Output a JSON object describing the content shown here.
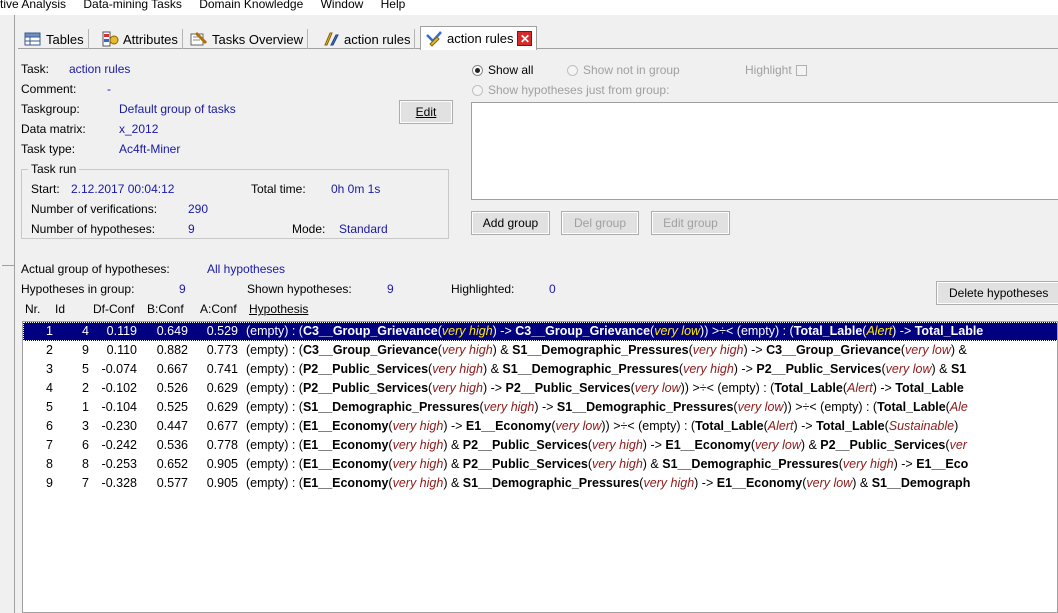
{
  "menu": [
    "tive Analysis",
    "Data-mining Tasks",
    "Domain Knowledge",
    "Window",
    "Help"
  ],
  "tabs": [
    {
      "label": "Tables",
      "icon": "table-icon"
    },
    {
      "label": "Attributes",
      "icon": "attributes-icon"
    },
    {
      "label": "Tasks Overview",
      "icon": "tasks-overview-icon"
    },
    {
      "label": "action rules",
      "icon": "action-rules-icon"
    },
    {
      "label": "action rules",
      "icon": "action-rules-icon",
      "active": true
    }
  ],
  "task": {
    "task_label": "Task:",
    "task_value": "action rules",
    "comment_label": "Comment:",
    "comment_value": "-",
    "taskgroup_label": "Taskgroup:",
    "taskgroup_value": "Default group of tasks",
    "datamatrix_label": "Data matrix:",
    "datamatrix_value": "x_2012",
    "tasktype_label": "Task type:",
    "tasktype_value": "Ac4ft-Miner",
    "edit_button": "Edit"
  },
  "taskrun": {
    "legend": "Task run",
    "start_label": "Start:",
    "start_value": "2.12.2017 00:04:12",
    "totaltime_label": "Total time:",
    "totaltime_value": "0h 0m 1s",
    "verifications_label": "Number of verifications:",
    "verifications_value": "290",
    "hypotheses_label": "Number of hypotheses:",
    "hypotheses_value": "9",
    "mode_label": "Mode:",
    "mode_value": "Standard"
  },
  "filter": {
    "show_all": "Show all",
    "show_not_in_group": "Show not in group",
    "highlight": "Highlight",
    "show_from_group": "Show hypotheses just from group:",
    "add_group": "Add group",
    "del_group": "Del group",
    "edit_group": "Edit group"
  },
  "summary": {
    "actual_group_label": "Actual group of hypotheses:",
    "actual_group_value": "All hypotheses",
    "in_group_label": "Hypotheses in group:",
    "in_group_value": "9",
    "shown_label": "Shown hypotheses:",
    "shown_value": "9",
    "highlighted_label": "Highlighted:",
    "highlighted_value": "0",
    "delete_button": "Delete hypotheses"
  },
  "columns": [
    "Nr.",
    "Id",
    "Df-Conf",
    "B:Conf",
    "A:Conf",
    "Hypothesis"
  ],
  "rows": [
    {
      "nr": "1",
      "id": "4",
      "df": "0.119",
      "b": "0.649",
      "a": "0.529",
      "selected": true,
      "hyp": [
        [
          "t",
          "(empty) : ("
        ],
        [
          "b",
          "C3__Group_Grievance"
        ],
        [
          "t",
          "("
        ],
        [
          "i",
          "very high"
        ],
        [
          "t",
          ") -> "
        ],
        [
          "b",
          "C3__Group_Grievance"
        ],
        [
          "t",
          "("
        ],
        [
          "i",
          "very low"
        ],
        [
          "t",
          ")) >÷< (empty) : ("
        ],
        [
          "b",
          "Total_Lable"
        ],
        [
          "t",
          "("
        ],
        [
          "i",
          "Alert"
        ],
        [
          "t",
          ") -> "
        ],
        [
          "b",
          "Total_Lable"
        ]
      ]
    },
    {
      "nr": "2",
      "id": "9",
      "df": "0.110",
      "b": "0.882",
      "a": "0.773",
      "hyp": [
        [
          "t",
          "(empty) : ("
        ],
        [
          "b",
          "C3__Group_Grievance"
        ],
        [
          "t",
          "("
        ],
        [
          "i",
          "very high"
        ],
        [
          "t",
          ") & "
        ],
        [
          "b",
          "S1__Demographic_Pressures"
        ],
        [
          "t",
          "("
        ],
        [
          "i",
          "very high"
        ],
        [
          "t",
          ") -> "
        ],
        [
          "b",
          "C3__Group_Grievance"
        ],
        [
          "t",
          "("
        ],
        [
          "i",
          "very low"
        ],
        [
          "t",
          ") & "
        ]
      ]
    },
    {
      "nr": "3",
      "id": "5",
      "df": "-0.074",
      "b": "0.667",
      "a": "0.741",
      "hyp": [
        [
          "t",
          "(empty) : ("
        ],
        [
          "b",
          "P2__Public_Services"
        ],
        [
          "t",
          "("
        ],
        [
          "i",
          "very high"
        ],
        [
          "t",
          ") & "
        ],
        [
          "b",
          "S1__Demographic_Pressures"
        ],
        [
          "t",
          "("
        ],
        [
          "i",
          "very high"
        ],
        [
          "t",
          ") -> "
        ],
        [
          "b",
          "P2__Public_Services"
        ],
        [
          "t",
          "("
        ],
        [
          "i",
          "very low"
        ],
        [
          "t",
          ") & "
        ],
        [
          "b",
          "S1"
        ]
      ]
    },
    {
      "nr": "4",
      "id": "2",
      "df": "-0.102",
      "b": "0.526",
      "a": "0.629",
      "hyp": [
        [
          "t",
          "(empty) : ("
        ],
        [
          "b",
          "P2__Public_Services"
        ],
        [
          "t",
          "("
        ],
        [
          "i",
          "very high"
        ],
        [
          "t",
          ") -> "
        ],
        [
          "b",
          "P2__Public_Services"
        ],
        [
          "t",
          "("
        ],
        [
          "i",
          "very low"
        ],
        [
          "t",
          ")) >÷< (empty) : ("
        ],
        [
          "b",
          "Total_Lable"
        ],
        [
          "t",
          "("
        ],
        [
          "i",
          "Alert"
        ],
        [
          "t",
          ") -> "
        ],
        [
          "b",
          "Total_Lable"
        ]
      ]
    },
    {
      "nr": "5",
      "id": "1",
      "df": "-0.104",
      "b": "0.525",
      "a": "0.629",
      "hyp": [
        [
          "t",
          "(empty) : ("
        ],
        [
          "b",
          "S1__Demographic_Pressures"
        ],
        [
          "t",
          "("
        ],
        [
          "i",
          "very high"
        ],
        [
          "t",
          ") -> "
        ],
        [
          "b",
          "S1__Demographic_Pressures"
        ],
        [
          "t",
          "("
        ],
        [
          "i",
          "very low"
        ],
        [
          "t",
          ")) >÷< (empty) : ("
        ],
        [
          "b",
          "Total_Lable"
        ],
        [
          "t",
          "("
        ],
        [
          "i",
          "Ale"
        ]
      ]
    },
    {
      "nr": "6",
      "id": "3",
      "df": "-0.230",
      "b": "0.447",
      "a": "0.677",
      "hyp": [
        [
          "t",
          "(empty) : ("
        ],
        [
          "b",
          "E1__Economy"
        ],
        [
          "t",
          "("
        ],
        [
          "i",
          "very high"
        ],
        [
          "t",
          ") -> "
        ],
        [
          "b",
          "E1__Economy"
        ],
        [
          "t",
          "("
        ],
        [
          "i",
          "very low"
        ],
        [
          "t",
          ")) >÷< (empty) : ("
        ],
        [
          "b",
          "Total_Lable"
        ],
        [
          "t",
          "("
        ],
        [
          "i",
          "Alert"
        ],
        [
          "t",
          ") -> "
        ],
        [
          "b",
          "Total_Lable"
        ],
        [
          "t",
          "("
        ],
        [
          "i",
          "Sustainable"
        ],
        [
          "t",
          ")"
        ]
      ]
    },
    {
      "nr": "7",
      "id": "6",
      "df": "-0.242",
      "b": "0.536",
      "a": "0.778",
      "hyp": [
        [
          "t",
          "(empty) : ("
        ],
        [
          "b",
          "E1__Economy"
        ],
        [
          "t",
          "("
        ],
        [
          "i",
          "very high"
        ],
        [
          "t",
          ") & "
        ],
        [
          "b",
          "P2__Public_Services"
        ],
        [
          "t",
          "("
        ],
        [
          "i",
          "very high"
        ],
        [
          "t",
          ") -> "
        ],
        [
          "b",
          "E1__Economy"
        ],
        [
          "t",
          "("
        ],
        [
          "i",
          "very low"
        ],
        [
          "t",
          ") & "
        ],
        [
          "b",
          "P2__Public_Services"
        ],
        [
          "t",
          "("
        ],
        [
          "i",
          "ver"
        ]
      ]
    },
    {
      "nr": "8",
      "id": "8",
      "df": "-0.253",
      "b": "0.652",
      "a": "0.905",
      "hyp": [
        [
          "t",
          "(empty) : ("
        ],
        [
          "b",
          "E1__Economy"
        ],
        [
          "t",
          "("
        ],
        [
          "i",
          "very high"
        ],
        [
          "t",
          ") & "
        ],
        [
          "b",
          "P2__Public_Services"
        ],
        [
          "t",
          "("
        ],
        [
          "i",
          "very high"
        ],
        [
          "t",
          ") & "
        ],
        [
          "b",
          "S1__Demographic_Pressures"
        ],
        [
          "t",
          "("
        ],
        [
          "i",
          "very high"
        ],
        [
          "t",
          ") -> "
        ],
        [
          "b",
          "E1__Eco"
        ]
      ]
    },
    {
      "nr": "9",
      "id": "7",
      "df": "-0.328",
      "b": "0.577",
      "a": "0.905",
      "hyp": [
        [
          "t",
          "(empty) : ("
        ],
        [
          "b",
          "E1__Economy"
        ],
        [
          "t",
          "("
        ],
        [
          "i",
          "very high"
        ],
        [
          "t",
          ") & "
        ],
        [
          "b",
          "S1__Demographic_Pressures"
        ],
        [
          "t",
          "("
        ],
        [
          "i",
          "very high"
        ],
        [
          "t",
          ") -> "
        ],
        [
          "b",
          "E1__Economy"
        ],
        [
          "t",
          "("
        ],
        [
          "i",
          "very low"
        ],
        [
          "t",
          ") & "
        ],
        [
          "b",
          "S1__Demograph"
        ]
      ]
    }
  ]
}
